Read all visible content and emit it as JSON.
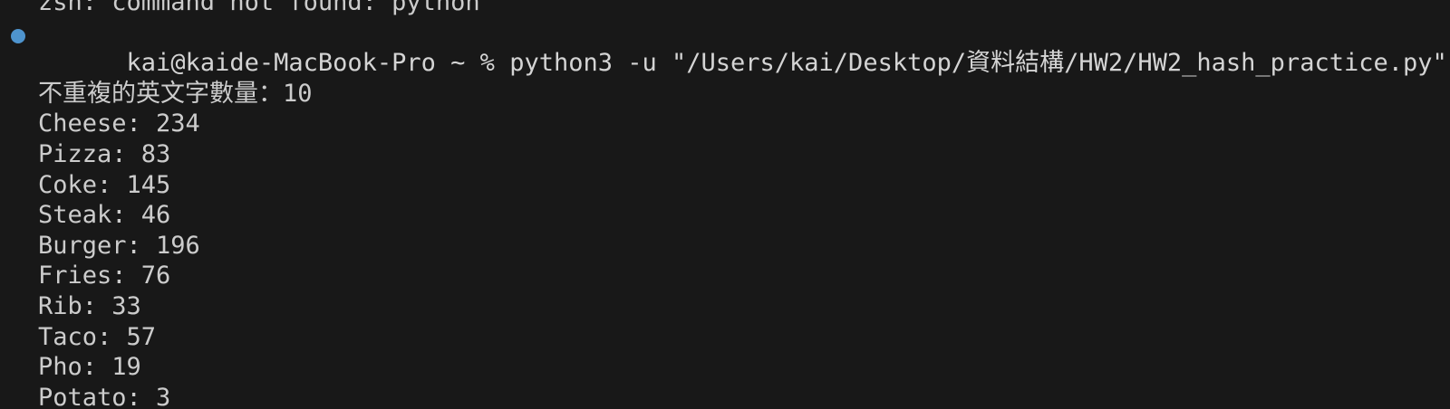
{
  "terminal": {
    "accent_color": "#4e94ce",
    "previous_output": "zsh: command not found: python",
    "prompt": "kai@kaide-MacBook-Pro ~ % ",
    "command": "python3 -u \"/Users/kai/Desktop/資料結構/HW2/HW2_hash_practice.py\"",
    "status_dot_icon": "circle-filled-icon",
    "output": {
      "summary": "不重複的英文字數量：10",
      "counts": [
        "Cheese: 234",
        "Pizza: 83",
        "Coke: 145",
        "Steak: 46",
        "Burger: 196",
        "Fries: 76",
        "Rib: 33",
        "Taco: 57",
        "Pho: 19",
        "Potato: 3"
      ]
    }
  }
}
